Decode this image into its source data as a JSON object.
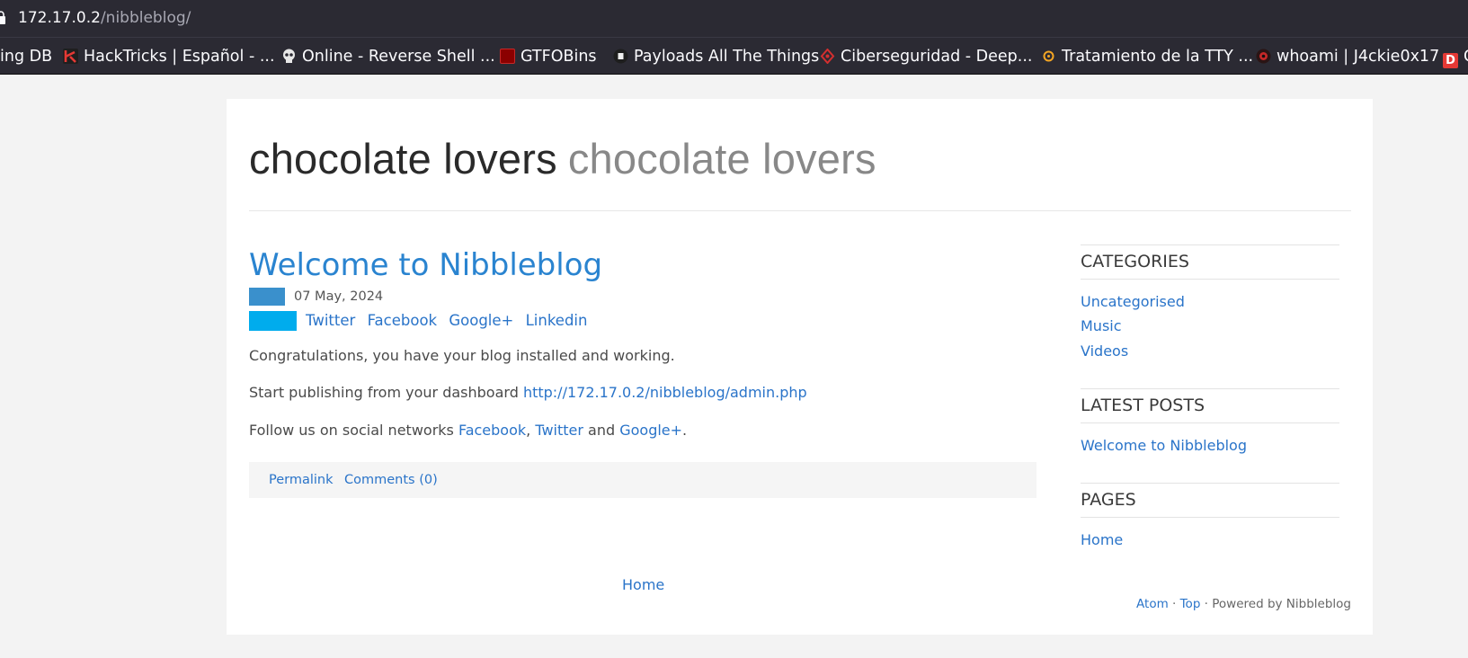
{
  "browser": {
    "url_host": "172.17.0.2",
    "url_path": "/nibbleblog/",
    "bookmarks": [
      {
        "label": "ing DB",
        "icon": "none"
      },
      {
        "label": "HackTricks | Español - ...",
        "icon": "hacktricks-icon"
      },
      {
        "label": "Online - Reverse Shell ...",
        "icon": "skull-icon"
      },
      {
        "label": "GTFOBins",
        "icon": "gtfobins-icon"
      },
      {
        "label": "Payloads All The Things",
        "icon": "payloads-icon"
      },
      {
        "label": "Ciberseguridad - Deep...",
        "icon": "deep-icon"
      },
      {
        "label": "Tratamiento de la TTY ...",
        "icon": "tty-icon"
      },
      {
        "label": "whoami | J4ckie0x17",
        "icon": "whoami-icon"
      },
      {
        "label": "C",
        "icon": "d-icon"
      }
    ]
  },
  "site": {
    "title": "chocolate lovers",
    "slogan": "chocolate lovers"
  },
  "post": {
    "title": "Welcome to Nibbleblog",
    "date": "07 May, 2024",
    "share": [
      "Twitter",
      "Facebook",
      "Google+",
      "Linkedin"
    ],
    "p1": "Congratulations, you have your blog installed and working.",
    "p2_prefix": "Start publishing from your dashboard ",
    "p2_link": "http://172.17.0.2/nibbleblog/admin.php",
    "p3_prefix": "Follow us on social networks ",
    "p3_facebook": "Facebook",
    "p3_comma": ", ",
    "p3_twitter": "Twitter",
    "p3_and": " and ",
    "p3_google": "Google+",
    "p3_end": ".",
    "permalink": "Permalink",
    "comments": "Comments (0)"
  },
  "nav": {
    "home": "Home"
  },
  "sidebar": {
    "categories_title": "CATEGORIES",
    "categories": [
      "Uncategorised",
      "Music",
      "Videos"
    ],
    "latest_title": "LATEST POSTS",
    "latest": [
      "Welcome to Nibbleblog"
    ],
    "pages_title": "PAGES",
    "pages": [
      "Home"
    ]
  },
  "footer": {
    "atom": "Atom",
    "sep": " · ",
    "top": "Top",
    "powered": " · Powered by Nibbleblog"
  }
}
